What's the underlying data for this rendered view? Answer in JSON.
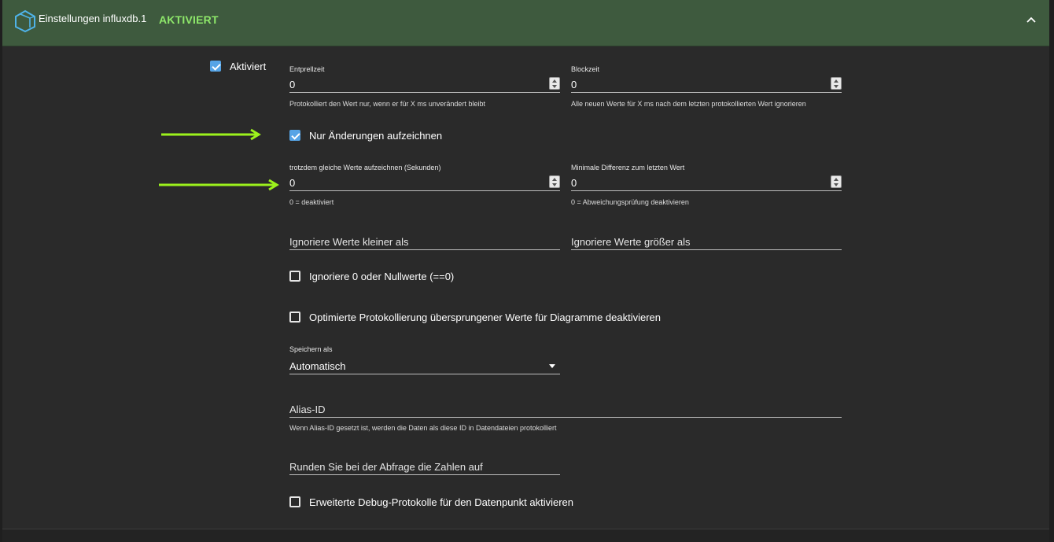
{
  "header": {
    "title": "Einstellungen influxdb.1",
    "status": "AKTIVIERT",
    "accent": "#8ee86a",
    "bg": "#3e5a3e",
    "logo_icon": "influxdb-cube-icon",
    "collapse_icon": "chevron-up-icon"
  },
  "enabled": {
    "label": "Aktiviert",
    "checked": true
  },
  "debounce": {
    "label": "Entprellzeit",
    "value": "0",
    "helper": "Protokolliert den Wert nur, wenn er für X ms unverändert bleibt"
  },
  "blocktime": {
    "label": "Blockzeit",
    "value": "0",
    "helper": "Alle neuen Werte für X ms nach dem letzten protokollierten Wert ignorieren"
  },
  "changes_only": {
    "label": "Nur Änderungen aufzeichnen",
    "checked": true
  },
  "same_values": {
    "label": "trotzdem gleiche Werte aufzeichnen (Sekunden)",
    "value": "0",
    "helper": "0 = deaktiviert"
  },
  "min_diff": {
    "label": "Minimale Differenz zum letzten Wert",
    "value": "0",
    "helper": "0 = Abweichungsprüfung deaktivieren"
  },
  "ignore_below": {
    "placeholder": "Ignoriere Werte kleiner als"
  },
  "ignore_above": {
    "placeholder": "Ignoriere Werte größer als"
  },
  "ignore_zero": {
    "label": "Ignoriere 0 oder Nullwerte (==0)",
    "checked": false
  },
  "disable_skipped": {
    "label": "Optimierte Protokollierung übersprungener Werte für Diagramme deaktivieren",
    "checked": false
  },
  "store_as": {
    "label": "Speichern als",
    "value": "Automatisch"
  },
  "alias": {
    "placeholder": "Alias-ID",
    "helper": "Wenn Alias-ID gesetzt ist, werden die Daten als diese ID in Datendateien protokolliert"
  },
  "round": {
    "placeholder": "Runden Sie bei der Abfrage die Zahlen auf"
  },
  "debug": {
    "label": "Erweiterte Debug-Protokolle für den Datenpunkt aktivieren",
    "checked": false
  },
  "annotation_color": "#9cf21c"
}
